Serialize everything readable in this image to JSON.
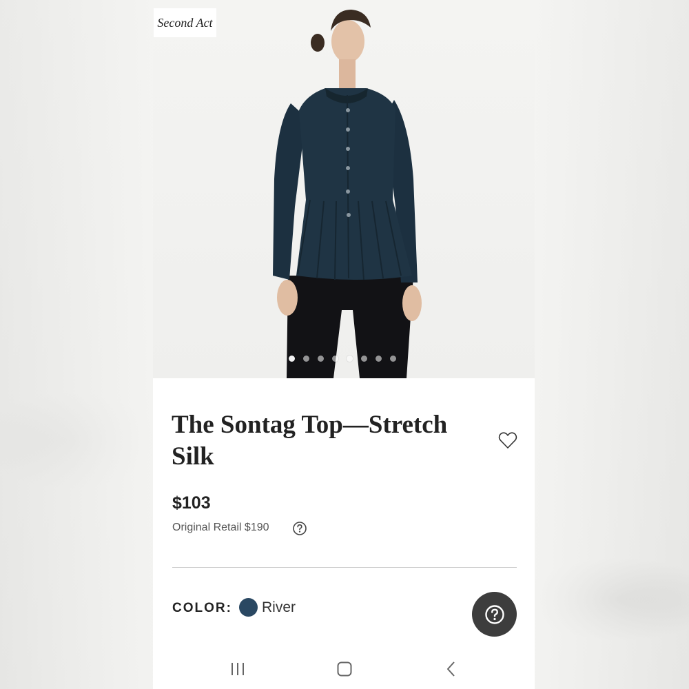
{
  "brand": {
    "watermark": "Second Act"
  },
  "gallery": {
    "slide_count": 8,
    "active_index": 0
  },
  "product": {
    "title": "The Sontag Top—Stretch Silk",
    "price": "$103",
    "original_retail": "Original Retail $190",
    "color_label": "COLOR:",
    "color_name": "River",
    "color_hex": "#2a4862"
  },
  "icons": {
    "favorite": "heart-outline-icon",
    "retail_help": "question-circle-icon",
    "help_fab": "question-circle-icon",
    "nav_recents": "recents-icon",
    "nav_home": "home-icon",
    "nav_back": "back-icon"
  },
  "colors": {
    "text": "#222222",
    "fab": "#3d3d3d",
    "divider": "#c9c9c9"
  }
}
